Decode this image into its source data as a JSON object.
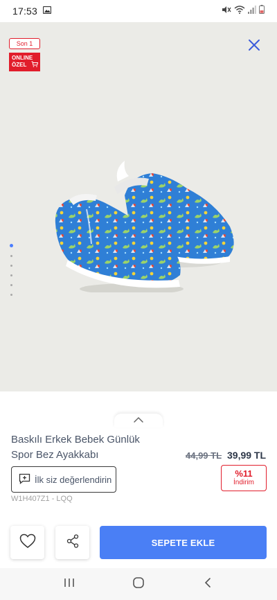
{
  "status_bar": {
    "time": "17:53"
  },
  "badges": {
    "son": "Son 1",
    "online_line1": "ONLINE",
    "online_line2": "ÖZEL"
  },
  "gallery": {
    "image_count": 6,
    "active_index": 0
  },
  "product": {
    "title_line1": "Baskılı Erkek Bebek Günlük",
    "title_line2": "Spor Bez Ayakkabı",
    "old_price": "44,99 TL",
    "new_price": "39,99 TL",
    "rate_label": "İlk siz değerlendirin",
    "discount_pct": "%11",
    "discount_label": "İndirim",
    "sku": "W1H407Z1 - LQQ"
  },
  "actions": {
    "add_to_cart": "SEPETE EKLE"
  },
  "colors": {
    "accent": "#4a7ff5",
    "sale_red": "#e11d2b"
  }
}
